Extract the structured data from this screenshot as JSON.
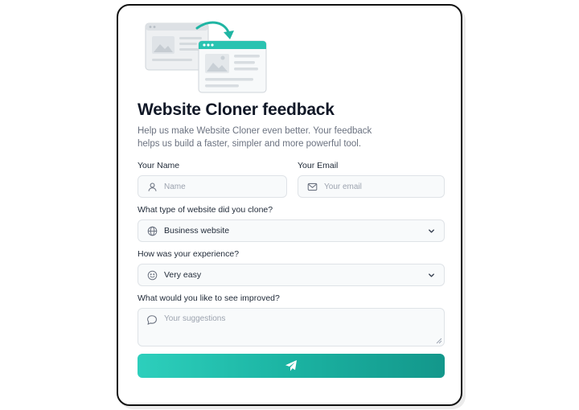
{
  "form": {
    "title": "Website Cloner feedback",
    "subtitle": "Help us make Website Cloner even better. Your feedback helps us build a faster, simpler and more powerful tool.",
    "name": {
      "label": "Your Name",
      "placeholder": "Name",
      "icon": "user-icon"
    },
    "email": {
      "label": "Your Email",
      "placeholder": "Your email",
      "icon": "mail-icon"
    },
    "website_type": {
      "label": "What type of website did you clone?",
      "selected": "Business website",
      "icon": "globe-icon"
    },
    "experience": {
      "label": "How was your experience?",
      "selected": "Very easy",
      "icon": "smile-icon"
    },
    "improvements": {
      "label": "What would you like to see improved?",
      "placeholder": "Your suggestions",
      "icon": "message-icon"
    },
    "submit": {
      "icon": "send-icon"
    }
  },
  "colors": {
    "accent_start": "#2dcfbc",
    "accent_end": "#13978b",
    "field_bg": "#f8fafb",
    "field_border": "#dfe3e7"
  }
}
